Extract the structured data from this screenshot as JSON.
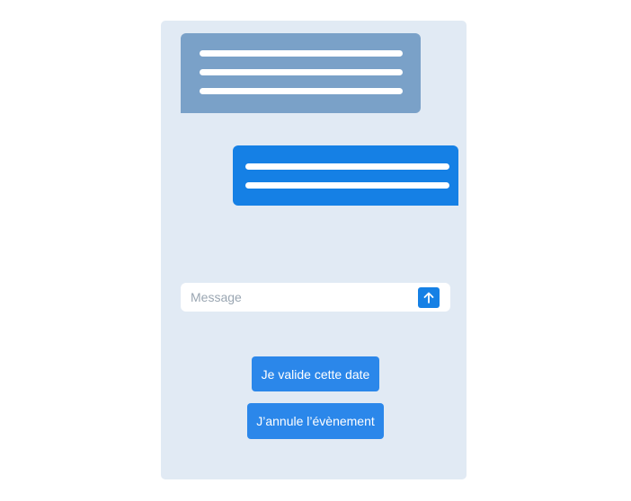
{
  "colors": {
    "panel_background": "#e1eaf4",
    "received_bubble": "#7aa1c8",
    "sent_bubble": "#1580e5",
    "action_button": "#2b87ea"
  },
  "conversation": {
    "messages": [
      {
        "direction": "received",
        "text_lines": 3
      },
      {
        "direction": "sent",
        "text_lines": 2
      }
    ]
  },
  "composer": {
    "placeholder": "Message",
    "send_icon": "arrow-up-icon"
  },
  "actions": {
    "validate_label": "Je valide cette date",
    "cancel_label": "J’annule l’évènement"
  }
}
